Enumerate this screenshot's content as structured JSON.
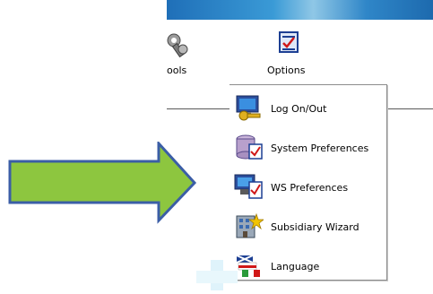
{
  "toolbar": {
    "tools_label": "ools",
    "options_label": "Options"
  },
  "menu": {
    "items": [
      {
        "label": "Log On/Out",
        "icon": "monitor-key-icon"
      },
      {
        "label": "System Preferences",
        "icon": "database-check-icon"
      },
      {
        "label": "WS Preferences",
        "icon": "workstation-check-icon"
      },
      {
        "label": "Subsidiary Wizard",
        "icon": "building-wizard-icon"
      },
      {
        "label": "Language",
        "icon": "flags-icon"
      }
    ]
  },
  "colors": {
    "arrow_fill": "#8dc63f",
    "arrow_stroke": "#3b5ea6",
    "menu_border": "#8c8c8c"
  }
}
